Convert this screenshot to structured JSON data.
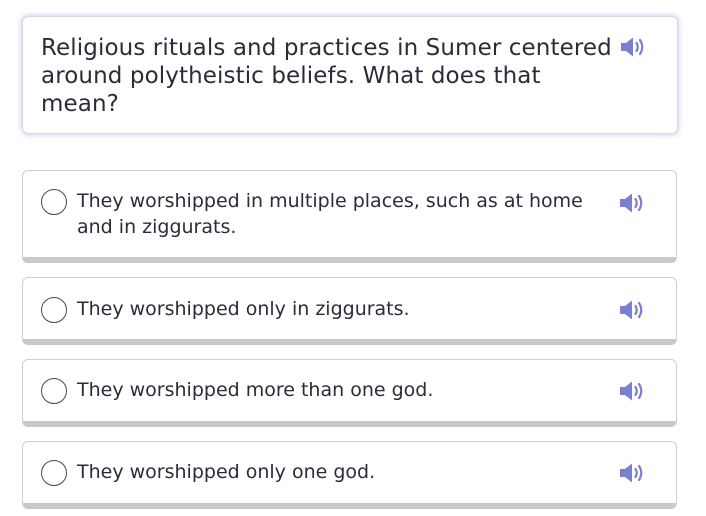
{
  "question": {
    "text": "Religious rituals and practices in Sumer centered around polytheistic beliefs. What does that mean?",
    "audio_icon": "speaker-icon"
  },
  "options": [
    {
      "label": "They worshipped in multiple places, such as at home and in ziggurats.",
      "selected": false
    },
    {
      "label": "They worshipped only in ziggurats.",
      "selected": false
    },
    {
      "label": "They worshipped more than one god.",
      "selected": false
    },
    {
      "label": "They worshipped only one god.",
      "selected": false
    }
  ],
  "colors": {
    "accent": "#7b7fd1",
    "card_border": "#d6d6ee",
    "option_shadow": "#c9c9c9",
    "text": "#2b2b3a"
  }
}
